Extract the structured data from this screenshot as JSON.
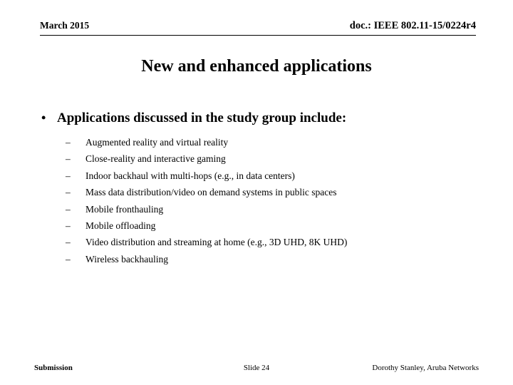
{
  "header": {
    "date": "March 2015",
    "doc_id": "doc.: IEEE 802.11-15/0224r4"
  },
  "title": "New and enhanced applications",
  "bullet": {
    "marker": "•",
    "text": "Applications discussed in the study group include:"
  },
  "sub_marker": "–",
  "sub_items": [
    "Augmented reality and virtual reality",
    "Close-reality and interactive gaming",
    "Indoor backhaul with multi-hops (e.g., in data centers)",
    "Mass data distribution/video on demand systems in public spaces",
    "Mobile fronthauling",
    "Mobile offloading",
    "Video distribution and streaming at home (e.g., 3D UHD, 8K UHD)",
    "Wireless backhauling"
  ],
  "footer": {
    "left": "Submission",
    "center": "Slide 24",
    "right": "Dorothy Stanley, Aruba Networks"
  }
}
